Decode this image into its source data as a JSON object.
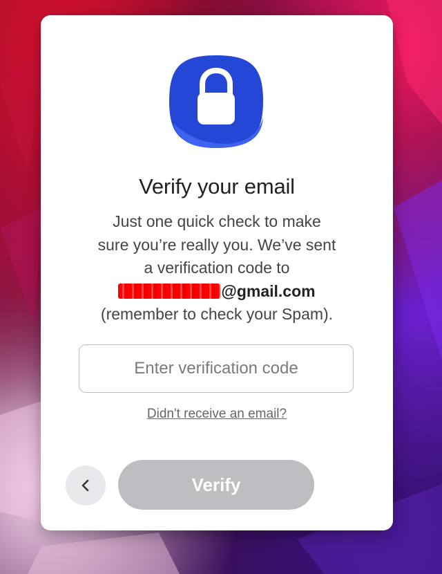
{
  "dialog": {
    "title": "Verify your email",
    "description_line1": "Just one quick check to make",
    "description_line2": "sure you’re really you. We’ve sent",
    "description_line3": "a verification code to",
    "email_domain": "@gmail.com",
    "description_line5": "(remember to check your Spam).",
    "code_input": {
      "placeholder": "Enter verification code",
      "value": ""
    },
    "resend_link": "Didn't receive an email?",
    "verify_button": "Verify",
    "back_button_icon": "chevron-left-icon",
    "header_icon": "lock-icon"
  },
  "colors": {
    "badge_blue": "#2447d6",
    "badge_blue_light": "#3f63ee",
    "verify_disabled": "#bdbec2",
    "back_button_bg": "#e8e9ec",
    "redaction": "#ff1a1a"
  }
}
